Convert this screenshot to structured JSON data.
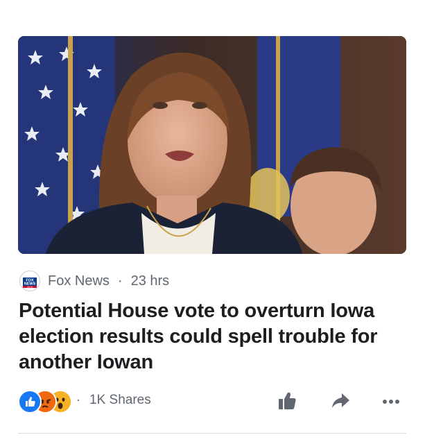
{
  "post": {
    "source_name": "Fox News",
    "separator": "·",
    "time": "23 hrs",
    "headline": "Potential House vote to overturn Iowa election results could spell trouble for another Iowan",
    "logo_text_top": "FOX",
    "logo_text_bottom": "NEWS",
    "logo_text_small": "channel"
  },
  "engagement": {
    "reactions": [
      "like-icon",
      "angry-icon",
      "wow-icon"
    ],
    "separator": "·",
    "shares": "1K Shares"
  },
  "actions": [
    "like-icon",
    "share-icon",
    "more-icon"
  ],
  "colors": {
    "like_blue": "#1877f2",
    "angry_orange": "#e9710f",
    "wow_yellow": "#f7b125",
    "meta_gray": "#606770",
    "headline_black": "#1c1e21",
    "action_gray": "#606770"
  }
}
